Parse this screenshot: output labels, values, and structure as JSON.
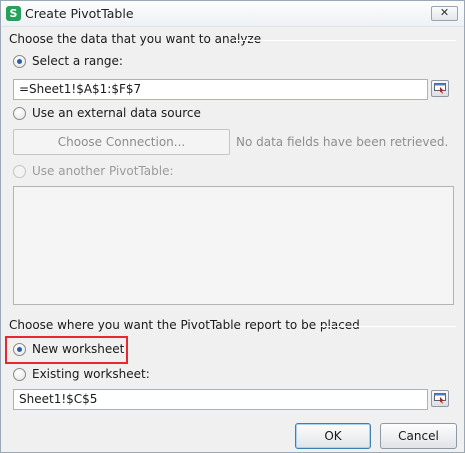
{
  "window": {
    "title": "Create PivotTable",
    "app_icon_glyph": "S"
  },
  "source_section": {
    "heading": "Choose the data that you want to analyze",
    "select_range": {
      "label": "Select a range:",
      "checked": true,
      "value": "=Sheet1!$A$1:$F$7"
    },
    "external_source": {
      "label": "Use an external data source",
      "checked": false
    },
    "choose_connection_label": "Choose Connection...",
    "no_data_note": "No data fields have been retrieved.",
    "another_pivot": {
      "label": "Use another PivotTable:",
      "disabled": true
    }
  },
  "destination_section": {
    "heading": "Choose where you want the PivotTable report to be placed",
    "new_worksheet": {
      "label": "New worksheet",
      "checked": true
    },
    "existing_worksheet": {
      "label": "Existing worksheet:",
      "checked": false,
      "value": "Sheet1!$C$5"
    }
  },
  "buttons": {
    "ok": "OK",
    "cancel": "Cancel"
  },
  "colors": {
    "highlight_border": "#e8282e",
    "radio_dot": "#2a5ea6",
    "app_icon": "#26a05b"
  }
}
